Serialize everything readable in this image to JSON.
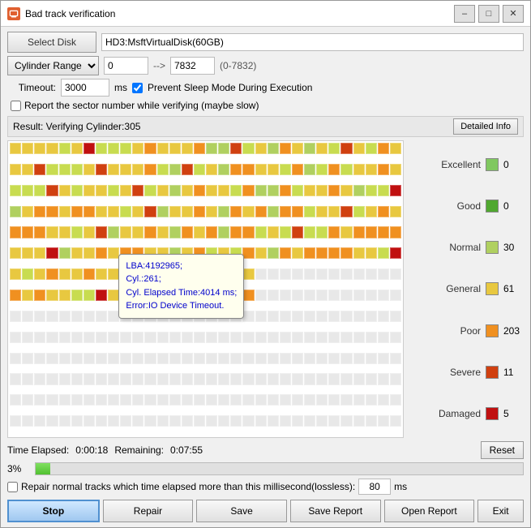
{
  "window": {
    "title": "Bad track verification",
    "icon": "disk-icon"
  },
  "toolbar": {
    "select_disk_label": "Select Disk",
    "disk_value": "HD3:MsftVirtualDisk(60GB)"
  },
  "cylinder_range": {
    "dropdown_value": "Cylinder Range",
    "from": "0",
    "arrow": "-->",
    "to": "7832",
    "range_hint": "(0-7832)"
  },
  "timeout": {
    "label": "Timeout:",
    "value": "3000",
    "unit": "ms",
    "prevent_sleep_label": "Prevent Sleep Mode During Execution",
    "prevent_sleep_checked": true
  },
  "report_sector": {
    "label": "Report the sector number while verifying (maybe slow)",
    "checked": false
  },
  "result": {
    "text": "Result:  Verifying Cylinder:305",
    "detailed_info_label": "Detailed Info"
  },
  "tooltip": {
    "line1": "LBA:4192965;",
    "line2": "Cyl.:261;",
    "line3": "Cyl. Elapsed Time:4014 ms;",
    "line4": "Error:IO Device Timeout."
  },
  "legend": {
    "items": [
      {
        "label": "Excellent",
        "color": "#80c860",
        "count": "0"
      },
      {
        "label": "Good",
        "color": "#50a830",
        "count": "0"
      },
      {
        "label": "Normal",
        "color": "#b0d060",
        "count": "30"
      },
      {
        "label": "General",
        "color": "#e8c840",
        "count": "61"
      },
      {
        "label": "Poor",
        "color": "#f09020",
        "count": "203"
      },
      {
        "label": "Severe",
        "color": "#d04010",
        "count": "11"
      },
      {
        "label": "Damaged",
        "color": "#c01010",
        "count": "5"
      }
    ]
  },
  "time": {
    "elapsed_label": "Time Elapsed:",
    "elapsed_value": "0:00:18",
    "remaining_label": "Remaining:",
    "remaining_value": "0:07:55",
    "reset_label": "Reset"
  },
  "progress": {
    "percent": "3%",
    "fill_width": "3"
  },
  "repair": {
    "label": "Repair normal tracks which time elapsed more than this millisecond(lossless):",
    "value": "80",
    "unit": "ms",
    "checked": false
  },
  "buttons": {
    "stop": "Stop",
    "repair": "Repair",
    "save": "Save",
    "save_report": "Save Report",
    "open_report": "Open Report",
    "exit": "Exit"
  },
  "grid": {
    "colors": {
      "empty": "#f0f0f0",
      "excellent": "#80c860",
      "good": "#50a830",
      "normal": "#c8dc50",
      "general": "#e8c840",
      "poor": "#f09020",
      "severe": "#d04010",
      "damaged": "#c01010",
      "unscanned": "#e8e8e8"
    }
  }
}
